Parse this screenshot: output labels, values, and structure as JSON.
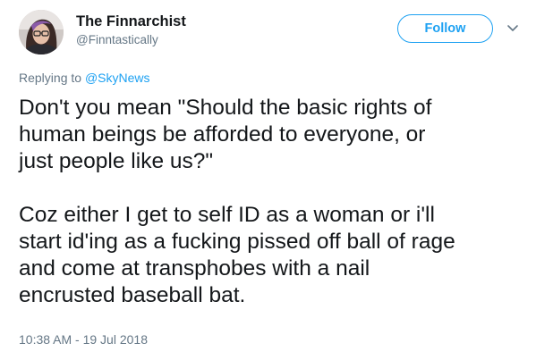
{
  "user": {
    "display_name": "The Finnarchist",
    "handle": "@Finntastically"
  },
  "actions": {
    "follow_label": "Follow",
    "more_icon": "chevron-down-icon"
  },
  "reply": {
    "prefix": "Replying to ",
    "mention": "@SkyNews"
  },
  "tweet": {
    "paragraph_1": "Don't you mean \"Should the basic rights of\nhuman beings be afforded to everyone, or\njust people like us?\"",
    "paragraph_2": "Coz either I get to self ID as a woman or i'll\nstart id'ing as a fucking pissed off ball of rage\nand come at transphobes with a nail\nencrusted baseball bat."
  },
  "timestamp": "10:38 AM - 19 Jul 2018",
  "colors": {
    "accent": "#1da1f2",
    "text": "#14171a",
    "secondary": "#657786"
  }
}
